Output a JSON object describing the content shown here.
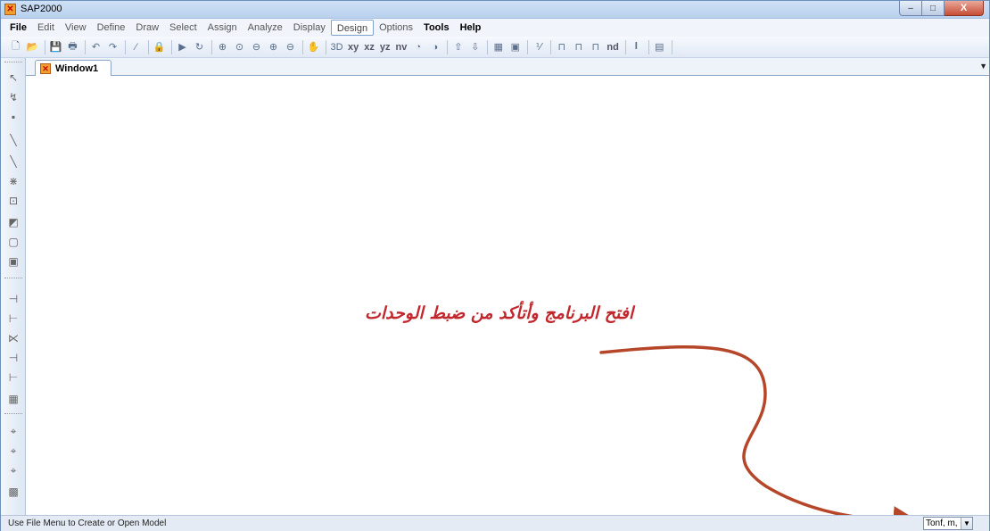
{
  "window": {
    "title": "SAP2000",
    "minimize": "–",
    "maximize": "□",
    "close": "X"
  },
  "menu": [
    "File",
    "Edit",
    "View",
    "Define",
    "Draw",
    "Select",
    "Assign",
    "Analyze",
    "Display",
    "Design",
    "Options",
    "Tools",
    "Help"
  ],
  "toolbar": {
    "text_buttons": [
      "xy",
      "xz",
      "yz",
      "nv",
      "nd"
    ]
  },
  "tab": {
    "label": "Window1",
    "dropdown": "▼"
  },
  "annotation": "افتح البرنامج وأتأكد من ضبط الوحدات",
  "status": {
    "message": "Use File Menu to Create or Open Model",
    "units": "Tonf, m, C",
    "units_arrow": "▼"
  },
  "colors": {
    "annotation": "#c1272d",
    "arrow": "#b5462a"
  }
}
